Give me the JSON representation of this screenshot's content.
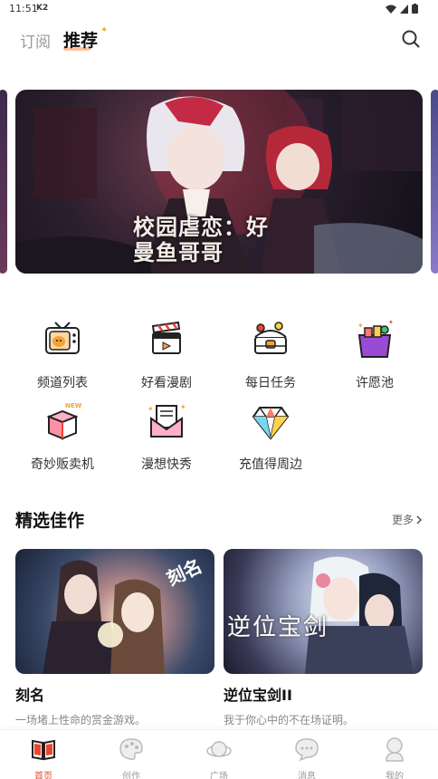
{
  "status_bar": {
    "time": "11:51",
    "carrier": "K2"
  },
  "header": {
    "tabs": [
      {
        "label": "订阅",
        "active": false
      },
      {
        "label": "推荐",
        "active": true
      }
    ],
    "search_icon": "search-icon"
  },
  "banner": {
    "title_line1": "校园虐恋：好",
    "title_line2": "曼鱼哥哥"
  },
  "features": [
    {
      "label": "频道列表",
      "icon": "tv-icon"
    },
    {
      "label": "好看漫剧",
      "icon": "clapperboard-icon"
    },
    {
      "label": "每日任务",
      "icon": "treasure-chest-icon"
    },
    {
      "label": "许愿池",
      "icon": "wish-gift-box-icon"
    },
    {
      "label": "奇妙贩卖机",
      "icon": "vending-box-icon"
    },
    {
      "label": "漫想快秀",
      "icon": "envelope-icon"
    },
    {
      "label": "充值得周边",
      "icon": "diamond-icon"
    }
  ],
  "section": {
    "title": "精选佳作",
    "more": "更多"
  },
  "cards": [
    {
      "title": "刻名",
      "desc": "一场堵上性命的赏金游戏。",
      "cover_text": "刻名"
    },
    {
      "title": "逆位宝剑II",
      "desc": "我于你心中的不在场证明。",
      "cover_text": "逆位宝剑"
    }
  ],
  "bottom_nav": [
    {
      "label": "首页",
      "icon": "book-icon",
      "active": true
    },
    {
      "label": "创作",
      "icon": "palette-icon",
      "active": false
    },
    {
      "label": "广场",
      "icon": "planet-icon",
      "active": false
    },
    {
      "label": "消息",
      "icon": "chat-bubble-icon",
      "active": false
    },
    {
      "label": "我的",
      "icon": "profile-icon",
      "active": false
    }
  ],
  "colors": {
    "accent": "#e8462f",
    "tab_underline": "#ffb07a",
    "muted": "#9a9a9a"
  }
}
